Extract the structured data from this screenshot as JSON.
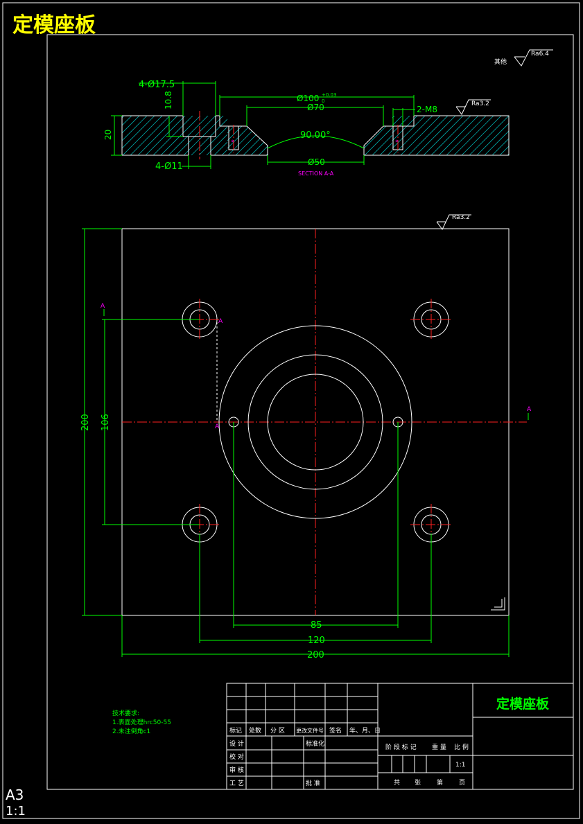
{
  "sheet": {
    "title": "定模座板",
    "paper_size": "A3",
    "scale_corner": "1:1"
  },
  "colors": {
    "background": "#000000",
    "outline": "#ffffff",
    "dimension": "#00ff00",
    "centerline": "#ff2020",
    "section_label": "#ff00ff",
    "title": "#ffff00",
    "hatch": "#00aaaa"
  },
  "roughness": {
    "other_label": "其他",
    "other_value": "Ra6.4",
    "section_value": "Ra3.2",
    "plan_value": "Ra3.2"
  },
  "section_view": {
    "label": "SECTION A-A",
    "dims": {
      "counterbore": "4-Ø17.5",
      "cb_depth": "10.8",
      "through_hole": "4-Ø11",
      "thickness": "20",
      "bore_100": "Ø100",
      "bore_100_tol": "+0.03",
      "bore_100_tol_low": "0",
      "bore_70": "Ø70",
      "tapped": "2-M8",
      "angle": "90.00°",
      "bore_50": "Ø50"
    }
  },
  "plan_view": {
    "section_marker": "A",
    "dims": {
      "height": "200",
      "bolt_spacing_y": "106",
      "screw_spacing": "85",
      "bolt_spacing_x": "120",
      "width": "200"
    }
  },
  "notes": {
    "heading": "技术要求:",
    "items": [
      "1.表面处理hrc50-55",
      "2.未注倒角c1"
    ]
  },
  "title_block": {
    "part_name": "定模座板",
    "header_row": [
      "标记",
      "处数",
      "分 区",
      "更改文件号",
      "签名",
      "年、月、日"
    ],
    "roles": [
      "设 计",
      "校 对",
      "审 核",
      "工 艺"
    ],
    "standardization": "标准化",
    "approval": "批 准",
    "stage_headers": [
      "阶 段 标 记",
      "重 量",
      "比 例"
    ],
    "scale": "1:1",
    "sheet_count": [
      "共",
      "张",
      "第",
      "页"
    ]
  }
}
